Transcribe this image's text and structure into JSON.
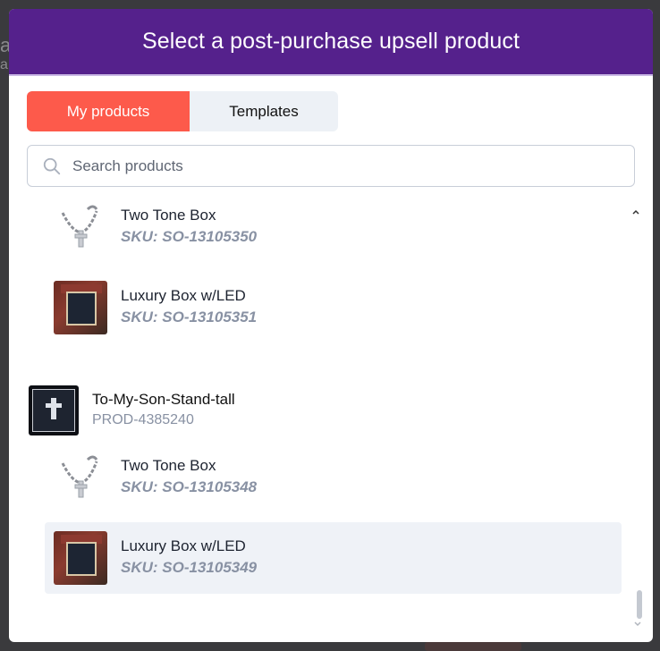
{
  "modal": {
    "title": "Select a post-purchase upsell product"
  },
  "tabs": [
    {
      "label": "My products",
      "active": true
    },
    {
      "label": "Templates",
      "active": false
    }
  ],
  "search": {
    "placeholder": "Search products",
    "value": ""
  },
  "list": {
    "items": [
      {
        "type": "variant",
        "name": "Two Tone Box",
        "sku": "SKU: SO-13105350",
        "icon": "necklace-thumbnail"
      },
      {
        "type": "variant",
        "name": "Luxury Box w/LED",
        "sku": "SKU: SO-13105351",
        "icon": "luxury-box-thumbnail"
      },
      {
        "type": "product",
        "name": "To-My-Son-Stand-tall",
        "id": "PROD-4385240",
        "icon": "product-card-thumbnail"
      },
      {
        "type": "variant",
        "name": "Two Tone Box",
        "sku": "SKU: SO-13105348",
        "icon": "necklace-thumbnail"
      },
      {
        "type": "variant",
        "name": "Luxury Box w/LED",
        "sku": "SKU: SO-13105349",
        "icon": "luxury-box-thumbnail",
        "highlighted": true
      }
    ]
  },
  "colors": {
    "header": "#55218c",
    "active_tab": "#fd5a4b",
    "sku_text": "#8891a3"
  },
  "backdrop": {
    "text1": "a",
    "text2": "a"
  }
}
